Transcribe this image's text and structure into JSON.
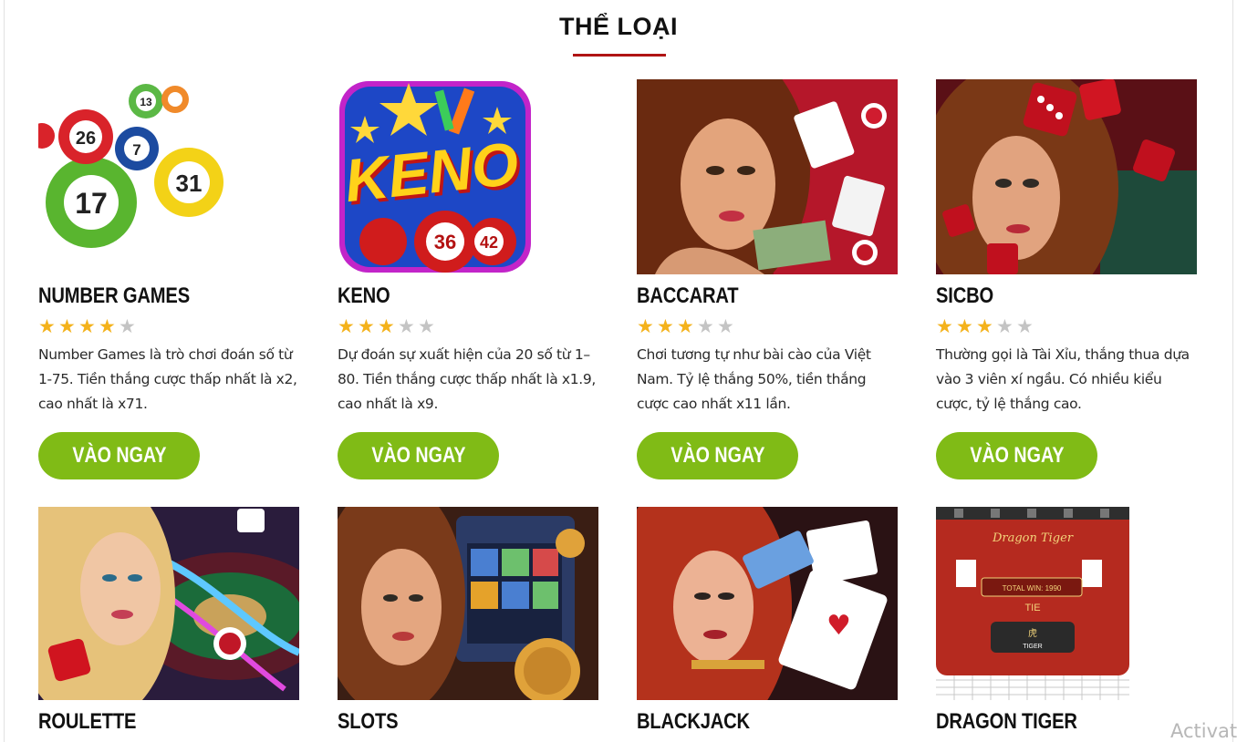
{
  "section": {
    "title": "THỂ LOẠI"
  },
  "accent_color": "#80bb16",
  "title_underline_color": "#b01414",
  "star_color": "#f4b21b",
  "play_label": "VÀO NGAY",
  "games": [
    {
      "name": "NUMBER GAMES",
      "rating": 4,
      "max_rating": 5,
      "image_icon": "lottery-balls-image",
      "description": "Number Games là trò chơi đoán số từ 1-75. Tiền thắng cược thấp nhất là x2, cao nhất là x71."
    },
    {
      "name": "KENO",
      "rating": 3,
      "max_rating": 5,
      "image_icon": "keno-logo-image",
      "description": "Dự đoán sự xuất hiện của 20 số từ 1–80. Tiền thắng cược thấp nhất là x1.9, cao nhất là x9."
    },
    {
      "name": "BACCARAT",
      "rating": 3,
      "max_rating": 5,
      "image_icon": "baccarat-image",
      "description": "Chơi tương tự như bài cào của Việt Nam. Tỷ lệ thắng 50%, tiền thắng cược cao nhất x11 lần."
    },
    {
      "name": "SICBO",
      "rating": 3,
      "max_rating": 5,
      "image_icon": "sicbo-dice-image",
      "description": "Thường gọi là Tài Xỉu, thắng thua dựa vào 3 viên xí ngầu. Có nhiều kiểu cược, tỷ lệ thắng cao."
    },
    {
      "name": "ROULETTE",
      "image_icon": "roulette-image"
    },
    {
      "name": "SLOTS",
      "image_icon": "slots-image"
    },
    {
      "name": "BLACKJACK",
      "image_icon": "blackjack-image"
    },
    {
      "name": "DRAGON TIGER",
      "image_icon": "dragon-tiger-image",
      "image_texts": {
        "brand": "Dragon Tiger",
        "tie": "TIE",
        "total_win": "TOTAL WIN: 1990",
        "tiger": "TIGER",
        "tiger_glyph": "虎"
      }
    }
  ],
  "watermark": "Activat"
}
